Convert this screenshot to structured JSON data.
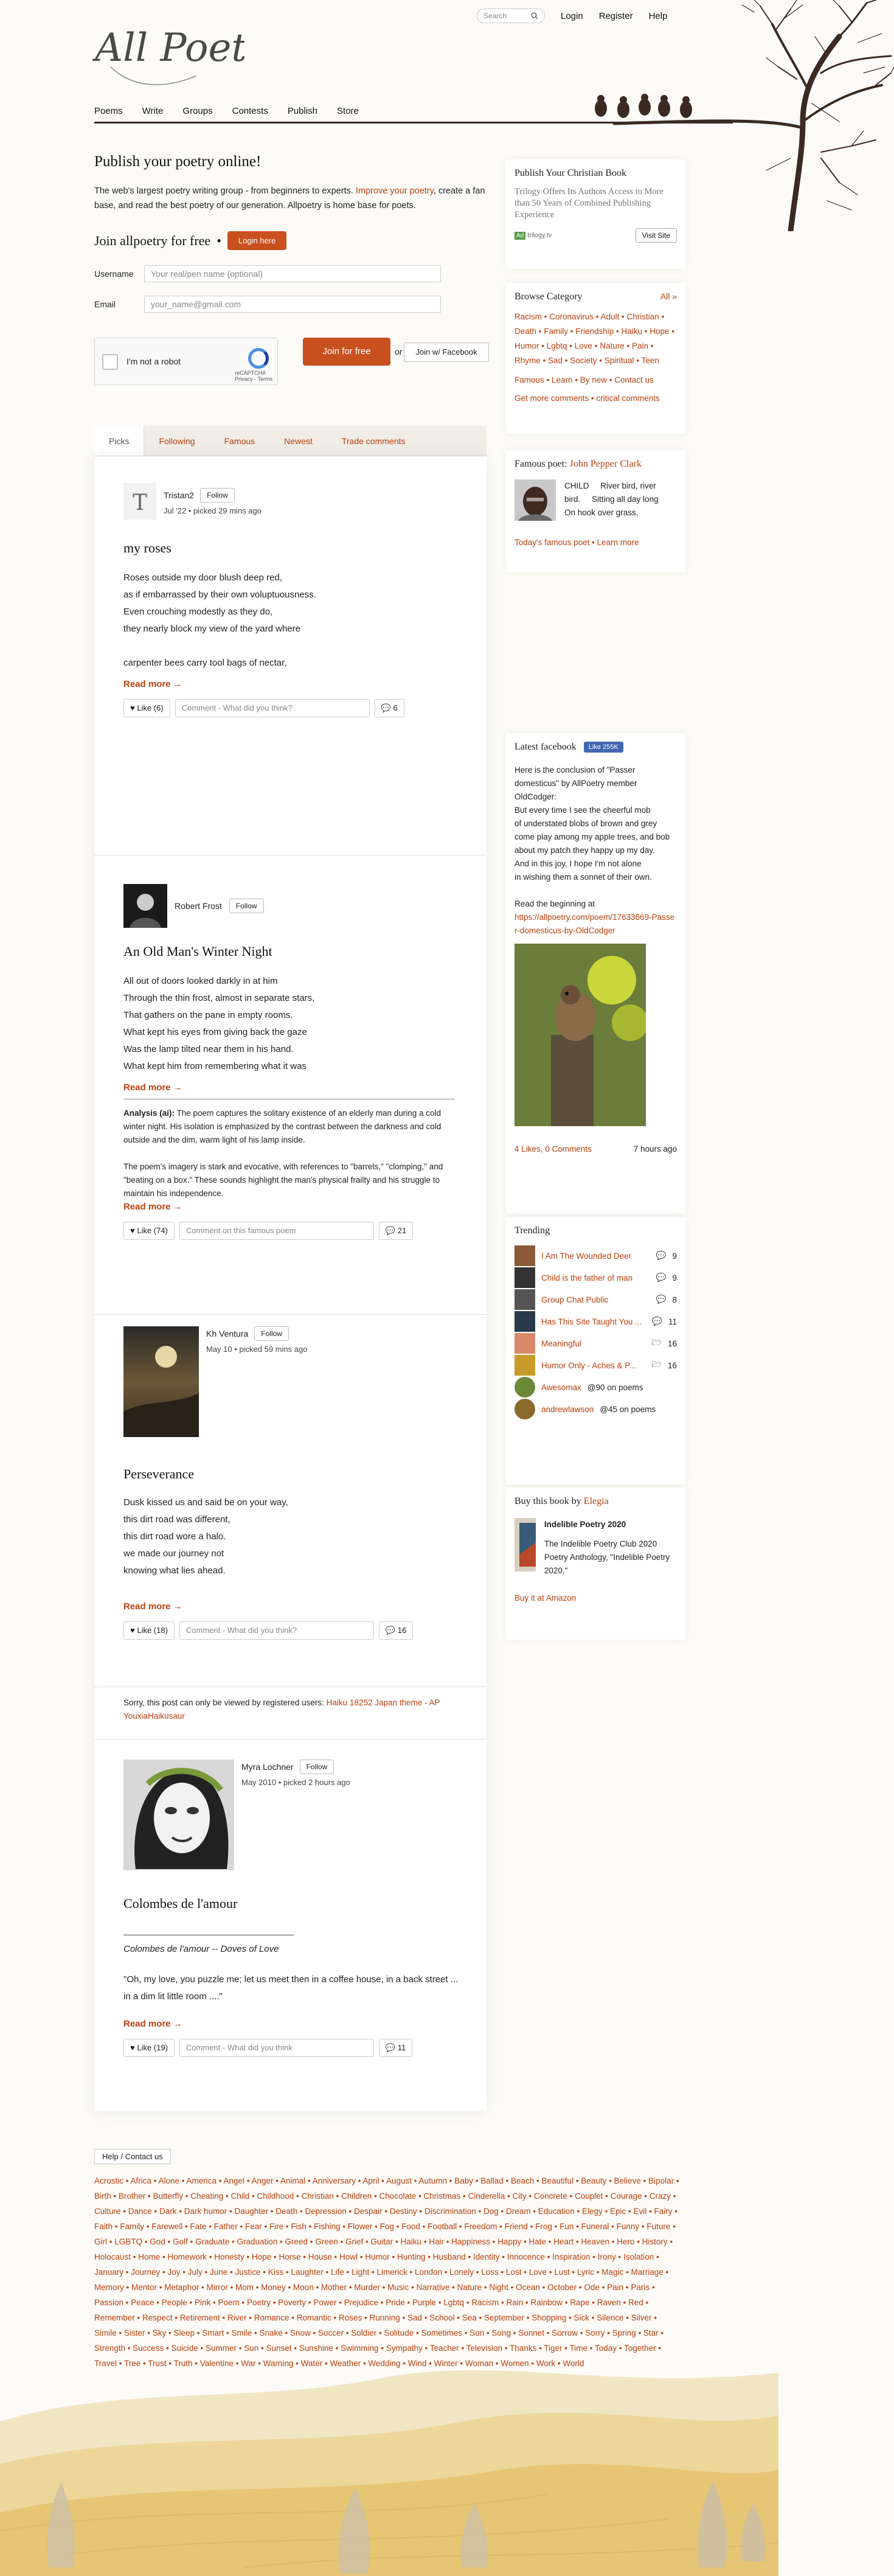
{
  "site": {
    "logo_text": "All Poetry"
  },
  "topnav": {
    "search_placeholder": "Search",
    "login": "Login",
    "register": "Register",
    "help": "Help"
  },
  "mainnav": [
    "Poems",
    "Write",
    "Groups",
    "Contests",
    "Publish",
    "Store"
  ],
  "hero": {
    "title": "Publish your poetry online!",
    "text_a": "The web's largest poetry writing group - from beginners to experts.",
    "text_link": "Improve your poetry",
    "text_b": ", create a fan base, and read the best poetry of our generation. Allpoetry is home base for poets."
  },
  "join": {
    "title": "Join allpoetry for free",
    "login_here": "Login here",
    "username_label": "Username",
    "username_placeholder": "Your real/pen name (optional)",
    "email_label": "Email",
    "email_placeholder": "your_name@gmail.com",
    "captcha_label": "I'm not a robot",
    "captcha_brand": "reCAPTCHA",
    "captcha_terms": "Privacy - Terms",
    "join_free": "Join for free",
    "or": "or",
    "join_facebook": "Join w/ Facebook"
  },
  "tabs": [
    "Picks",
    "Following",
    "Famous",
    "Newest",
    "Trade comments"
  ],
  "posts": [
    {
      "author": "Tristan2",
      "follow": "Follow",
      "date": "Jul '22",
      "picked": "picked 29 mins ago",
      "title": "my roses",
      "lines": [
        "Roses outside my door blush deep red,",
        "as if embarrassed by their own voluptuousness.",
        "Even crouching modestly as they do,",
        "they nearly block my view of the yard where",
        "",
        "carpenter bees carry tool bags of nectar,"
      ],
      "read_more": "Read more →",
      "like": "Like (6)",
      "comment_placeholder": "Comment - What did you think?",
      "comments": "6"
    },
    {
      "author": "Robert Frost",
      "follow": "Follow",
      "title": "An Old Man's Winter Night",
      "lines": [
        "All out of doors looked darkly in at him",
        "Through the thin frost, almost in separate stars,",
        "That gathers on the pane in empty rooms.",
        "What kept his eyes from giving back the gaze",
        "Was the lamp tilted near them in his hand.",
        "What kept him from remembering what it was"
      ],
      "read_more": "Read more →",
      "analysis_label": "Analysis (ai):",
      "analysis_1": "The poem captures the solitary existence of an elderly man during a cold winter night. His isolation is emphasized by the contrast between the darkness and cold outside and the dim, warm light of his lamp inside.",
      "analysis_2": "The poem's imagery is stark and evocative, with references to \"barrels,\" \"clomping,\" and \"beating on a box.\" These sounds highlight the man's physical frailty and his struggle to maintain his independence.",
      "read_more_2": "Read more →",
      "like": "Like (74)",
      "comment_placeholder": "Comment on this famous poem",
      "comments": "21"
    },
    {
      "author": "Kh Ventura",
      "follow": "Follow",
      "date": "May 10",
      "picked": "picked 59 mins ago",
      "title": "Perseverance",
      "lines": [
        "Dusk kissed us and said be on your way,",
        "this dirt road was different,",
        "this dirt road wore a halo.",
        "we made our journey not",
        "knowing what lies ahead."
      ],
      "read_more": "Read more →",
      "like": "Like (18)",
      "comment_placeholder": "Comment - What did you think?",
      "comments": "16"
    },
    {
      "restricted_text": "Sorry, this post can only be viewed by registered users:",
      "restricted_link": "Haiku 18252 Japan theme - AP YouxiaHaikusaur"
    },
    {
      "author": "Myra Lochner",
      "follow": "Follow",
      "date": "May 2010",
      "picked": "picked 2 hours ago",
      "title": "Colombes de l'amour",
      "subtitle": "Colombes de l'amour -- Doves of Love",
      "lines": [
        "\"Oh, my love, you puzzle me; let us meet then in a coffee house, in a back street ...",
        "in a dim lit little room ....\""
      ],
      "read_more": "Read more →",
      "like": "Like (19)",
      "comment_placeholder": "Comment - What did you think",
      "comments": "11"
    }
  ],
  "ad": {
    "title": "Publish Your Christian Book",
    "text": "Trilogy Offers Its Authors Access to More than 50 Years of Combined Publishing Experience",
    "badge": "Ad",
    "source": "trilogy.tv",
    "button": "Visit Site"
  },
  "browse": {
    "title": "Browse Category",
    "all": "All »",
    "categories": [
      "Racism",
      "Coronavirus",
      "Adult",
      "Christian",
      "Death",
      "Family",
      "Friendship",
      "Haiku",
      "Hope",
      "Humor",
      "Lgbtq",
      "Love",
      "Nature",
      "Pain",
      "Rhyme",
      "Sad",
      "Society",
      "Spiritual",
      "Teen"
    ],
    "links": [
      "Famous",
      "Learn",
      "By new",
      "Contact us"
    ],
    "more": "Get more comments • critical comments"
  },
  "famous_poet": {
    "label": "Famous poet:",
    "name": "John Pepper Clark",
    "lines": [
      "CHILD     River bird, river",
      "bird.     Sitting all day long",
      "On hook over grass,"
    ],
    "footer": "Today's famous poet • Learn more"
  },
  "facebook": {
    "title": "Latest facebook",
    "like_badge": "Like 255K",
    "text_1": "Here is the conclusion of \"Passer domesticus\" by AllPoetry member OldCodger:",
    "lines": [
      "But every time I see the cheerful mob",
      "of understated blobs of brown and grey",
      "come play among my apple trees, and bob",
      "about my patch they happy up my day.",
      "And in this joy, I hope I'm not alone",
      "in wishing them a sonnet of their own."
    ],
    "text_2": "Read the beginning at",
    "link": "https://allpoetry.com/poem/17633669-Passer-domesticus-by-OldCodger",
    "likes": "4 Likes, 0 Comments",
    "time": "7 hours ago"
  },
  "trending": {
    "title": "Trending",
    "items": [
      {
        "title": "I Am The Wounded Deer",
        "count": "9"
      },
      {
        "title": "Child is the father of man",
        "count": "9"
      },
      {
        "title": "Group Chat Public",
        "count": "8"
      },
      {
        "title": "Has This Site Taught You ...",
        "count": "11"
      },
      {
        "title": "Meaningful",
        "count": "16"
      },
      {
        "title": "Humor Only - Aches & P...",
        "count": "16"
      }
    ],
    "people": [
      {
        "name": "Awesomax",
        "stat": "@90 on poems"
      },
      {
        "name": "andrewlawson",
        "stat": "@45 on poems"
      }
    ]
  },
  "book": {
    "label": "Buy this book by",
    "author": "Elegia",
    "title": "Indelible Poetry 2020",
    "desc": "The Indelible Poetry Club 2020 Poetry Anthology, \"Indelible Poetry 2020,\"",
    "buy": "Buy it at Amazon"
  },
  "footer": {
    "help": "Help / Contact us",
    "tags": "Acrostic • Africa • Alone • America • Angel • Anger • Animal • Anniversary • April • August • Autumn • Baby • Ballad • Beach • Beautiful • Beauty • Believe • Bipolar • Birth • Brother • Butterfly • Cheating • Child • Childhood • Christian • Children • Chocolate • Christmas • Cinderella • City • Concrete • Couplet • Courage • Crazy • Culture • Dance • Dark • Dark humor • Daughter • Death • Depression • Despair • Destiny • Discrimination • Dog • Dream • Education • Elegy • Epic • Evil • Fairy • Faith • Family • Farewell • Fate • Father • Fear • Fire • Fish • Fishing • Flower • Fog • Food • Football • Freedom • Friend • Frog • Fun • Funeral • Funny • Future • Girl • LGBTQ • God • Golf • Graduate • Graduation • Greed • Green • Grief • Guitar • Haiku • Hair • Happiness • Happy • Hate • Heart • Heaven • Hero • History • Holocaust • Home • Homework • Honesty • Hope • Horse • House • Howl • Humor • Hunting • Husband • Identity • Innocence • Inspiration • Irony • Isolation • January • Journey • Joy • July • June • Justice • Kiss • Laughter • Life • Light • Limerick • London • Lonely • Loss • Lost • Love • Lust • Lyric • Magic • Marriage • Memory • Mentor • Metaphor • Mirror • Mom • Money • Moon • Mother • Murder • Music • Narrative • Nature • Night • Ocean • October • Ode • Pain • Paris • Passion • Peace • People • Pink • Poem • Poetry • Poverty • Power • Prejudice • Pride • Purple • Lgbtq • Racism • Rain • Rainbow • Rape • Raven • Red • Remember • Respect • Retirement • River • Romance • Romantic • Roses • Running • Sad • School • Sea • September • Shopping • Sick • Silence • Silver • Simile • Sister • Sky • Sleep • Smart • Smile • Snake • Snow • Soccer • Soldier • Solitude • Sometimes • Son • Song • Sonnet • Sorrow • Sorry • Spring • Star • Strength • Success • Suicide • Summer • Sun • Sunset • Sunshine • Swimming • Sympathy • Teacher • Television • Thanks • Tiger • Time • Today • Together • Travel • Tree • Trust • Truth • Valentine • War • Warning • Water • Weather • Wedding • Wind • Winter • Woman • Women • Work • World"
  },
  "colors": {
    "accent": "#b8400e",
    "button": "#c8501f",
    "background": "#fcfbf7",
    "facebook": "#4267b2"
  },
  "icons": [
    "search-icon",
    "heart-icon",
    "comment-icon",
    "folder-icon",
    "tree-illustration",
    "birds-illustration",
    "hills-illustration"
  ]
}
